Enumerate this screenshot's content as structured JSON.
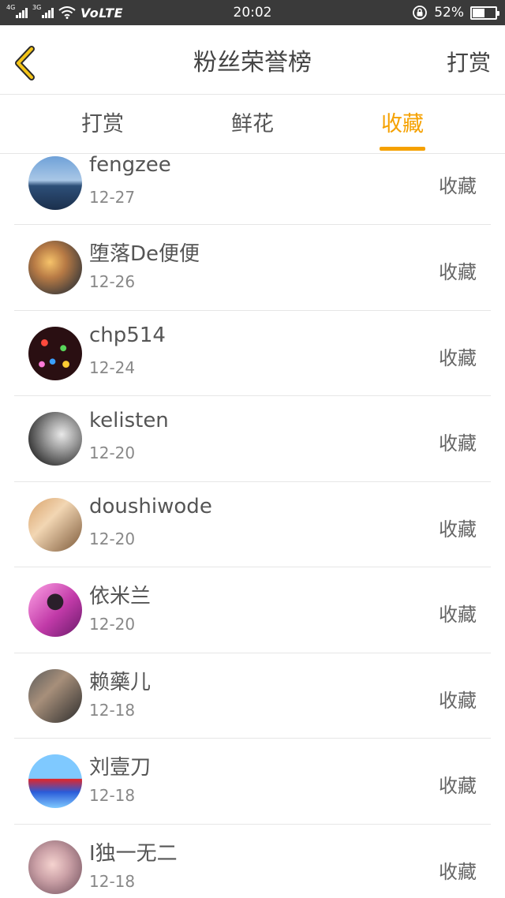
{
  "status_bar": {
    "net1": "4G",
    "net2": "3G",
    "volte": "VoLTE",
    "time": "20:02",
    "battery": "52%",
    "battery_level": 0.52
  },
  "header": {
    "title": "粉丝荣誉榜",
    "action": "打赏"
  },
  "tabs": [
    {
      "label": "打赏",
      "active": false
    },
    {
      "label": "鲜花",
      "active": false
    },
    {
      "label": "收藏",
      "active": true
    }
  ],
  "accent_color": "#f5a100",
  "list": [
    {
      "name": "fengzee",
      "date": "12-27",
      "type": "收藏"
    },
    {
      "name": "堕落De便便",
      "date": "12-26",
      "type": "收藏"
    },
    {
      "name": "chp514",
      "date": "12-24",
      "type": "收藏"
    },
    {
      "name": "kelisten",
      "date": "12-20",
      "type": "收藏"
    },
    {
      "name": "doushiwode",
      "date": "12-20",
      "type": "收藏"
    },
    {
      "name": "依米兰",
      "date": "12-20",
      "type": "收藏"
    },
    {
      "name": "赖藥儿",
      "date": "12-18",
      "type": "收藏"
    },
    {
      "name": "刘壹刀",
      "date": "12-18",
      "type": "收藏"
    },
    {
      "name": "I独一无二",
      "date": "12-18",
      "type": "收藏"
    }
  ]
}
